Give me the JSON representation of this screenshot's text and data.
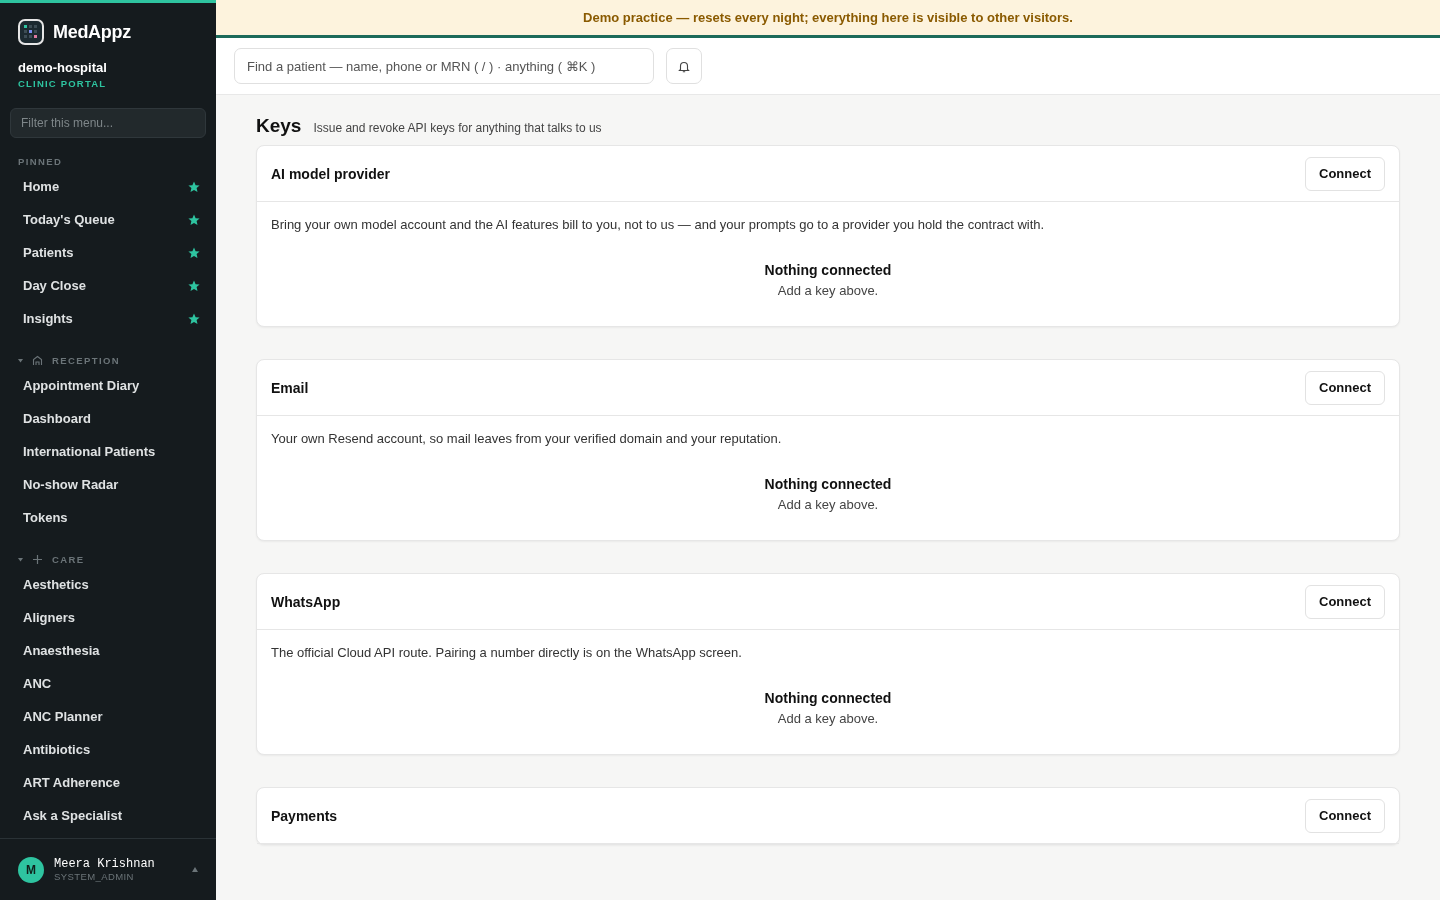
{
  "sidebar": {
    "brand": "MedAppz",
    "org": "demo-hospital",
    "portal": "CLINIC PORTAL",
    "filter_placeholder": "Filter this menu...",
    "sections": [
      {
        "label": "PINNED",
        "kind": "pinned",
        "items": [
          {
            "label": "Home",
            "pinned": true
          },
          {
            "label": "Today's Queue",
            "pinned": true
          },
          {
            "label": "Patients",
            "pinned": true
          },
          {
            "label": "Day Close",
            "pinned": true
          },
          {
            "label": "Insights",
            "pinned": true
          }
        ]
      },
      {
        "label": "RECEPTION",
        "kind": "reception",
        "expanded": true,
        "items": [
          {
            "label": "Appointment Diary",
            "pinned": false
          },
          {
            "label": "Dashboard",
            "pinned": false
          },
          {
            "label": "International Patients",
            "pinned": false
          },
          {
            "label": "No-show Radar",
            "pinned": false
          },
          {
            "label": "Tokens",
            "pinned": false
          }
        ]
      },
      {
        "label": "CARE",
        "kind": "care",
        "expanded": true,
        "items": [
          {
            "label": "Aesthetics",
            "pinned": false
          },
          {
            "label": "Aligners",
            "pinned": false
          },
          {
            "label": "Anaesthesia",
            "pinned": false
          },
          {
            "label": "ANC",
            "pinned": false
          },
          {
            "label": "ANC Planner",
            "pinned": false
          },
          {
            "label": "Antibiotics",
            "pinned": false
          },
          {
            "label": "ART Adherence",
            "pinned": false
          },
          {
            "label": "Ask a Specialist",
            "pinned": false
          }
        ]
      }
    ],
    "user": {
      "initial": "M",
      "name": "Meera Krishnan",
      "role": "SYSTEM_ADMIN"
    }
  },
  "banner": "Demo practice — resets every night; everything here is visible to other visitors.",
  "search": {
    "placeholder": "Find a patient — name, phone or MRN ( / ) · anything ( ⌘K )"
  },
  "page": {
    "title": "Keys",
    "subtitle": "Issue and revoke API keys for anything that talks to us"
  },
  "cards": [
    {
      "title": "AI model provider",
      "button": "Connect",
      "description": "Bring your own model account and the AI features bill to you, not to us — and your prompts go to a provider you hold the contract with.",
      "empty_title": "Nothing connected",
      "empty_hint": "Add a key above."
    },
    {
      "title": "Email",
      "button": "Connect",
      "description": "Your own Resend account, so mail leaves from your verified domain and your reputation.",
      "empty_title": "Nothing connected",
      "empty_hint": "Add a key above."
    },
    {
      "title": "WhatsApp",
      "button": "Connect",
      "description": "The official Cloud API route. Pairing a number directly is on the WhatsApp screen.",
      "empty_title": "Nothing connected",
      "empty_hint": "Add a key above."
    },
    {
      "title": "Payments",
      "button": "Connect"
    }
  ]
}
